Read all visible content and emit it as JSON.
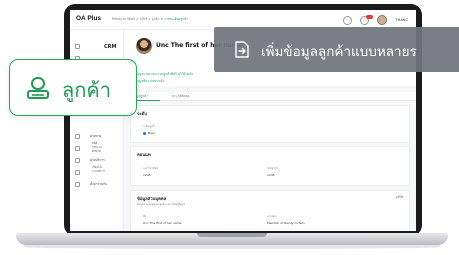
{
  "topbar": {
    "logo": "OA Plus",
    "breadcrumb": "Ready to Work  >  CRM  >  ลูกค้า  >",
    "breadcrumb_active": "รายละเอียดลูกค้า",
    "user_name": "THANC"
  },
  "sidebar": {
    "title": "CRM",
    "group_a": "ฝ่ายขาย",
    "group_a_items": [
      "ลีดส์",
      "ร่วมงาน",
      "ดีลขาย"
    ],
    "group_b": "ฝ่ายบริการ",
    "group_b_items": [
      "เรื่องแจ้ง",
      "งานบริการ"
    ],
    "group_c": "ตั้งค่าร่วมกัน"
  },
  "profile": {
    "name": "Unc The first of her name",
    "links": [
      "ข้อมูลรายงานจะรวมลูกค้าที่สร้างไว้ด้วยกัน",
      "ข้อมูลที่ตรวจสอบแล้ว"
    ]
  },
  "tabs": [
    "ข้อมูลลูกค้า",
    "ประวัติติดต่อ"
  ],
  "cards": {
    "status": {
      "title": "ระดับ",
      "label": "ระดับลูกค้า",
      "value": "Blue"
    },
    "contact": {
      "title": "คอนแท",
      "fields": [
        {
          "label": "เบอร์โทรศัพท์",
          "value": "1245"
        },
        {
          "label": "รหัสลูกค้า",
          "value": "1245"
        }
      ]
    },
    "personal": {
      "title": "ข้อมูลส่วนบุคคล",
      "subtitle": "ข้อมูลส่วนบุคคลของลูกค้าและบริษัทผู้ติดต่อ",
      "edit": "แก้ไข",
      "fields": [
        {
          "label": "ชื่อ",
          "value": "Unc The first of her name"
        },
        {
          "label": "นามสกุล",
          "value": "Member of Randy m/Tam"
        }
      ]
    }
  },
  "overlay": {
    "banner_text": "เพิ่มข้อมูลลูกค้าแบบหลายร",
    "pill_text": "ลูกค้า",
    "accent_color": "#1f9d55",
    "banner_color": "#72747c"
  }
}
